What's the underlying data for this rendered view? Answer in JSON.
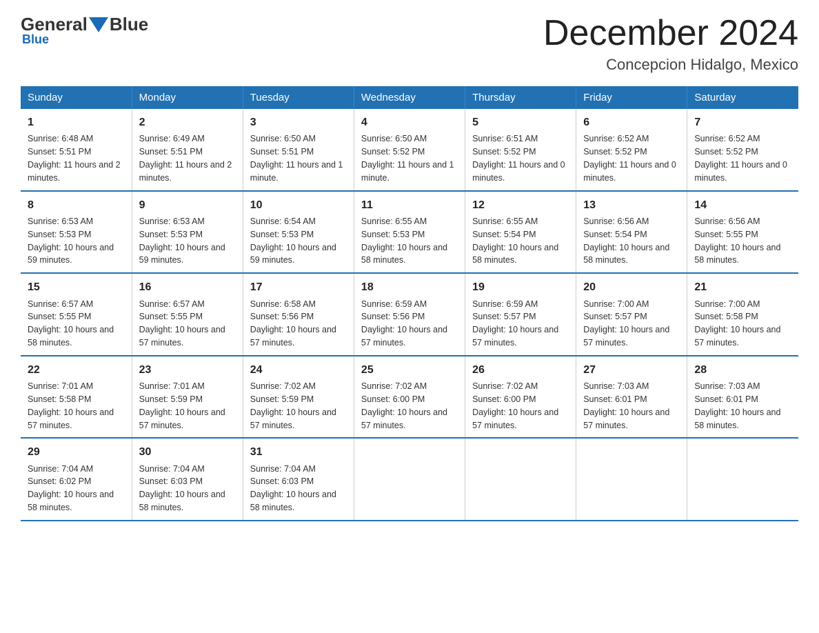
{
  "logo": {
    "general": "General",
    "blue": "Blue"
  },
  "title": "December 2024",
  "subtitle": "Concepcion Hidalgo, Mexico",
  "headers": [
    "Sunday",
    "Monday",
    "Tuesday",
    "Wednesday",
    "Thursday",
    "Friday",
    "Saturday"
  ],
  "weeks": [
    [
      {
        "day": "1",
        "sunrise": "6:48 AM",
        "sunset": "5:51 PM",
        "daylight": "11 hours and 2 minutes."
      },
      {
        "day": "2",
        "sunrise": "6:49 AM",
        "sunset": "5:51 PM",
        "daylight": "11 hours and 2 minutes."
      },
      {
        "day": "3",
        "sunrise": "6:50 AM",
        "sunset": "5:51 PM",
        "daylight": "11 hours and 1 minute."
      },
      {
        "day": "4",
        "sunrise": "6:50 AM",
        "sunset": "5:52 PM",
        "daylight": "11 hours and 1 minute."
      },
      {
        "day": "5",
        "sunrise": "6:51 AM",
        "sunset": "5:52 PM",
        "daylight": "11 hours and 0 minutes."
      },
      {
        "day": "6",
        "sunrise": "6:52 AM",
        "sunset": "5:52 PM",
        "daylight": "11 hours and 0 minutes."
      },
      {
        "day": "7",
        "sunrise": "6:52 AM",
        "sunset": "5:52 PM",
        "daylight": "11 hours and 0 minutes."
      }
    ],
    [
      {
        "day": "8",
        "sunrise": "6:53 AM",
        "sunset": "5:53 PM",
        "daylight": "10 hours and 59 minutes."
      },
      {
        "day": "9",
        "sunrise": "6:53 AM",
        "sunset": "5:53 PM",
        "daylight": "10 hours and 59 minutes."
      },
      {
        "day": "10",
        "sunrise": "6:54 AM",
        "sunset": "5:53 PM",
        "daylight": "10 hours and 59 minutes."
      },
      {
        "day": "11",
        "sunrise": "6:55 AM",
        "sunset": "5:53 PM",
        "daylight": "10 hours and 58 minutes."
      },
      {
        "day": "12",
        "sunrise": "6:55 AM",
        "sunset": "5:54 PM",
        "daylight": "10 hours and 58 minutes."
      },
      {
        "day": "13",
        "sunrise": "6:56 AM",
        "sunset": "5:54 PM",
        "daylight": "10 hours and 58 minutes."
      },
      {
        "day": "14",
        "sunrise": "6:56 AM",
        "sunset": "5:55 PM",
        "daylight": "10 hours and 58 minutes."
      }
    ],
    [
      {
        "day": "15",
        "sunrise": "6:57 AM",
        "sunset": "5:55 PM",
        "daylight": "10 hours and 58 minutes."
      },
      {
        "day": "16",
        "sunrise": "6:57 AM",
        "sunset": "5:55 PM",
        "daylight": "10 hours and 57 minutes."
      },
      {
        "day": "17",
        "sunrise": "6:58 AM",
        "sunset": "5:56 PM",
        "daylight": "10 hours and 57 minutes."
      },
      {
        "day": "18",
        "sunrise": "6:59 AM",
        "sunset": "5:56 PM",
        "daylight": "10 hours and 57 minutes."
      },
      {
        "day": "19",
        "sunrise": "6:59 AM",
        "sunset": "5:57 PM",
        "daylight": "10 hours and 57 minutes."
      },
      {
        "day": "20",
        "sunrise": "7:00 AM",
        "sunset": "5:57 PM",
        "daylight": "10 hours and 57 minutes."
      },
      {
        "day": "21",
        "sunrise": "7:00 AM",
        "sunset": "5:58 PM",
        "daylight": "10 hours and 57 minutes."
      }
    ],
    [
      {
        "day": "22",
        "sunrise": "7:01 AM",
        "sunset": "5:58 PM",
        "daylight": "10 hours and 57 minutes."
      },
      {
        "day": "23",
        "sunrise": "7:01 AM",
        "sunset": "5:59 PM",
        "daylight": "10 hours and 57 minutes."
      },
      {
        "day": "24",
        "sunrise": "7:02 AM",
        "sunset": "5:59 PM",
        "daylight": "10 hours and 57 minutes."
      },
      {
        "day": "25",
        "sunrise": "7:02 AM",
        "sunset": "6:00 PM",
        "daylight": "10 hours and 57 minutes."
      },
      {
        "day": "26",
        "sunrise": "7:02 AM",
        "sunset": "6:00 PM",
        "daylight": "10 hours and 57 minutes."
      },
      {
        "day": "27",
        "sunrise": "7:03 AM",
        "sunset": "6:01 PM",
        "daylight": "10 hours and 57 minutes."
      },
      {
        "day": "28",
        "sunrise": "7:03 AM",
        "sunset": "6:01 PM",
        "daylight": "10 hours and 58 minutes."
      }
    ],
    [
      {
        "day": "29",
        "sunrise": "7:04 AM",
        "sunset": "6:02 PM",
        "daylight": "10 hours and 58 minutes."
      },
      {
        "day": "30",
        "sunrise": "7:04 AM",
        "sunset": "6:03 PM",
        "daylight": "10 hours and 58 minutes."
      },
      {
        "day": "31",
        "sunrise": "7:04 AM",
        "sunset": "6:03 PM",
        "daylight": "10 hours and 58 minutes."
      },
      null,
      null,
      null,
      null
    ]
  ],
  "cell_labels": {
    "sunrise": "Sunrise: ",
    "sunset": "Sunset: ",
    "daylight": "Daylight: "
  }
}
